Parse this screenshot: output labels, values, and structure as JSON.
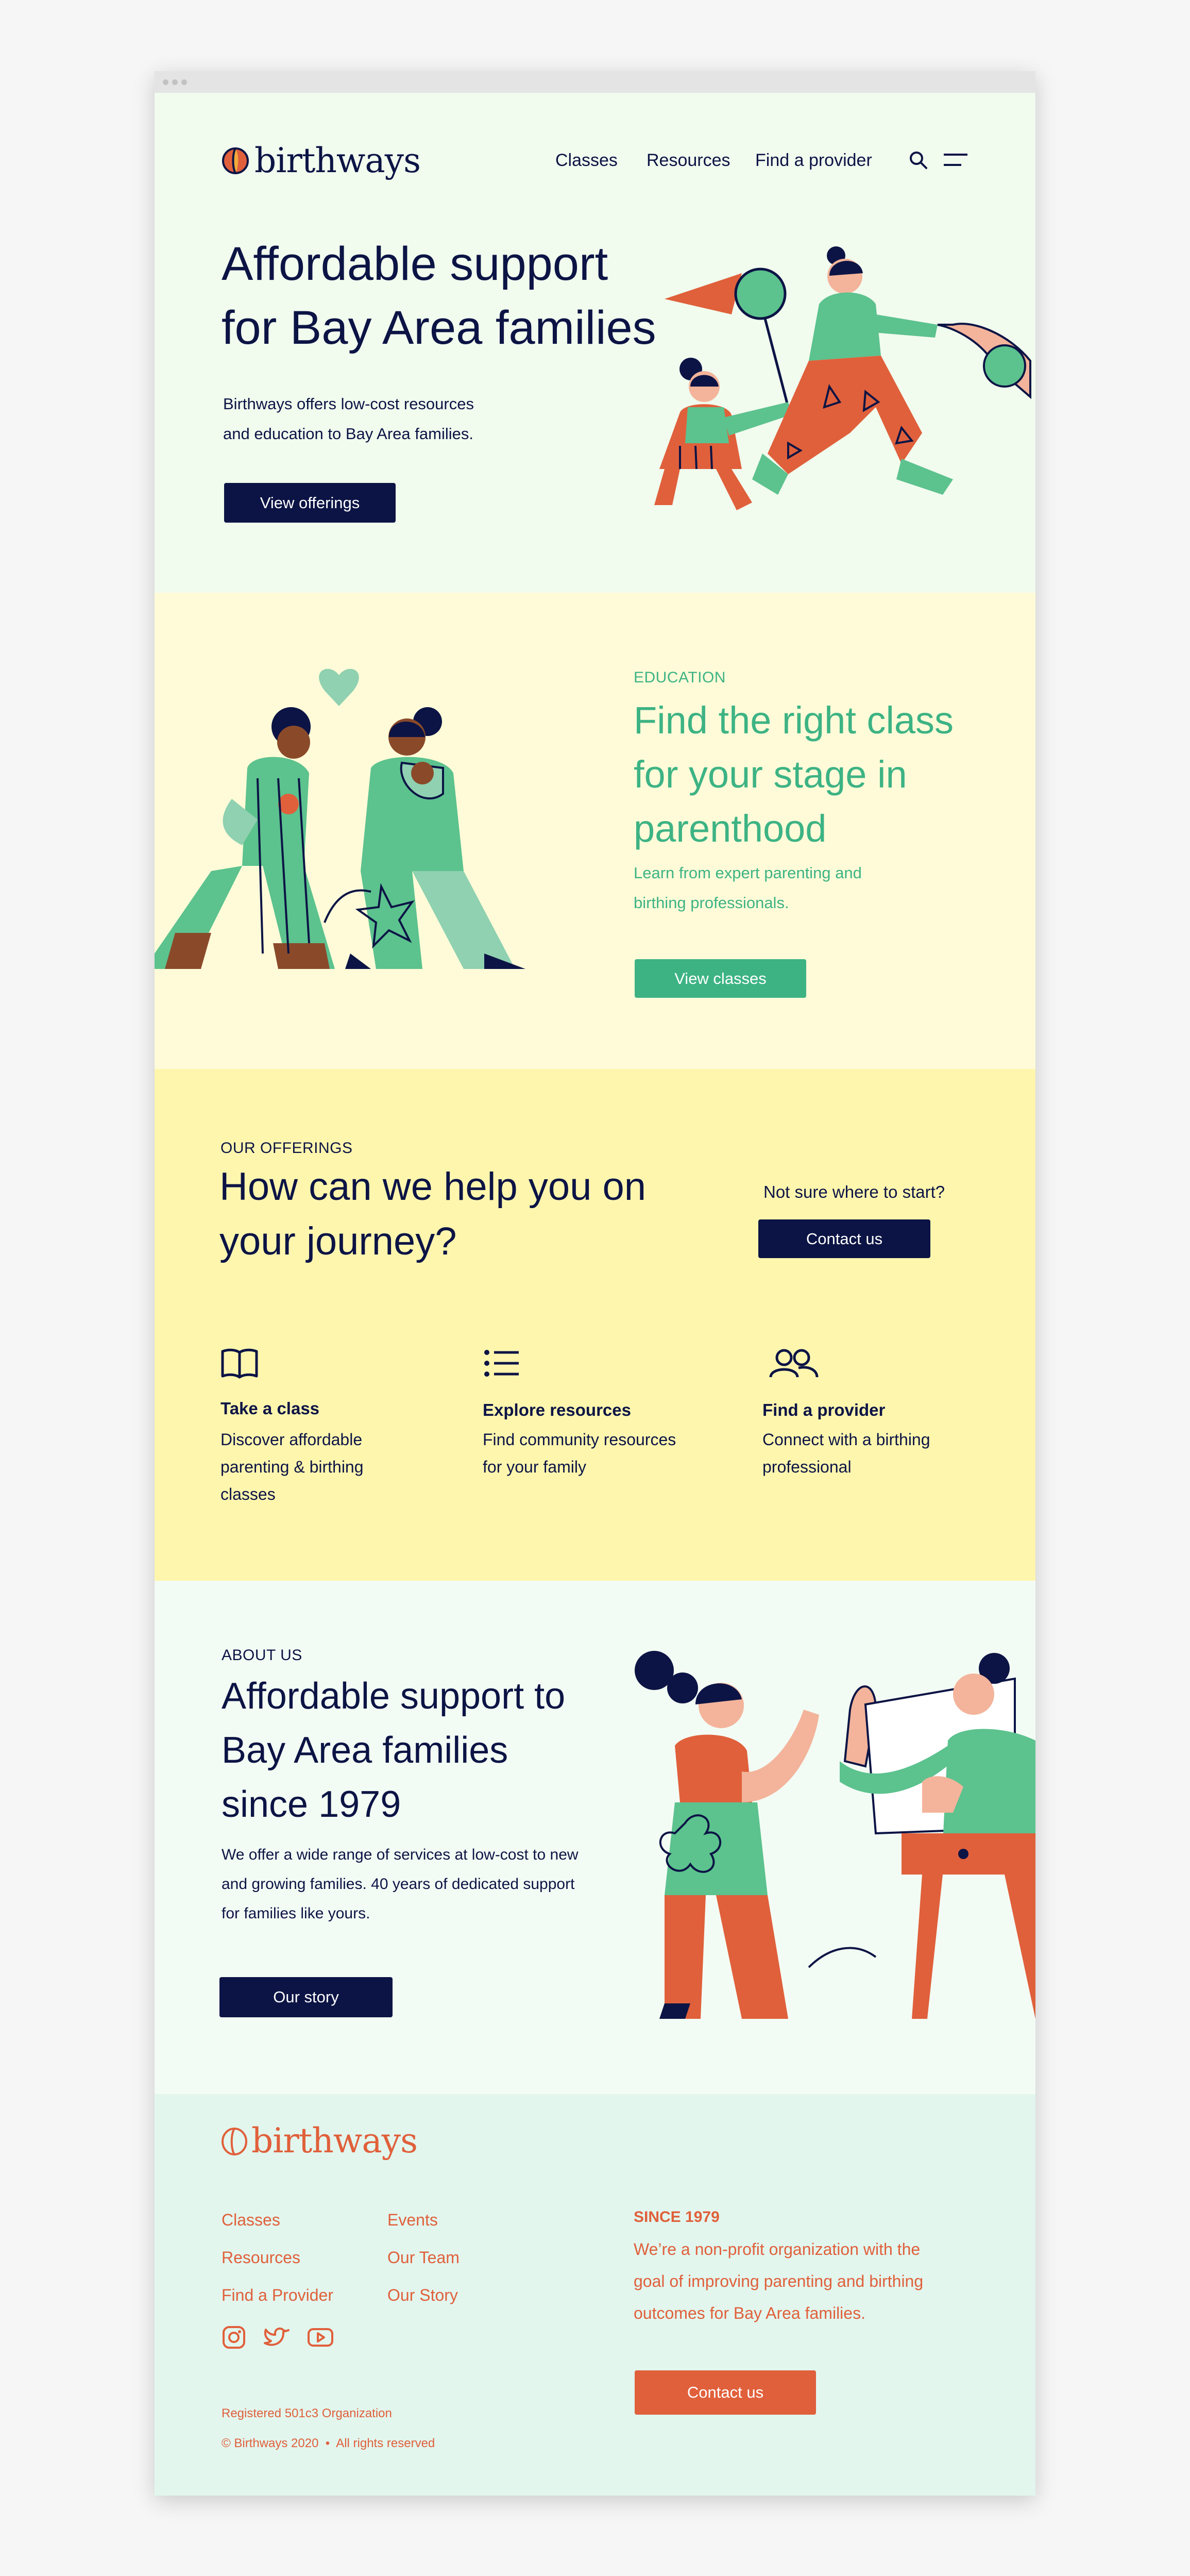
{
  "brand": {
    "name": "birthways"
  },
  "nav": {
    "items": [
      "Classes",
      "Resources",
      "Find a provider"
    ]
  },
  "hero": {
    "title_line1": "Affordable support",
    "title_line2": "for Bay Area families",
    "body_line1": "Birthways offers low-cost resources",
    "body_line2": "and education to Bay Area families.",
    "cta": "View offerings"
  },
  "education": {
    "eyebrow": "EDUCATION",
    "title_line1": "Find the right class",
    "title_line2": "for your stage in",
    "title_line3": "parenthood",
    "body_line1": "Learn from expert parenting and",
    "body_line2": "birthing professionals.",
    "cta": "View classes"
  },
  "offerings": {
    "eyebrow": "OUR OFFERINGS",
    "title_line1": "How can we help you on",
    "title_line2": "your journey?",
    "aside": "Not sure where to start?",
    "contact_cta": "Contact us",
    "items": [
      {
        "icon": "book-icon",
        "title": "Take a class",
        "desc_lines": [
          "Discover affordable",
          "parenting & birthing",
          "classes"
        ]
      },
      {
        "icon": "list-icon",
        "title": "Explore resources",
        "desc_lines": [
          "Find community resources",
          "for your family"
        ]
      },
      {
        "icon": "people-icon",
        "title": "Find a provider",
        "desc_lines": [
          "Connect with a birthing",
          "professional"
        ]
      }
    ]
  },
  "about": {
    "eyebrow": "ABOUT US",
    "title_line1": "Affordable support to",
    "title_line2": "Bay Area families",
    "title_line3": "since 1979",
    "body_line1": "We offer a wide range of services at low-cost to new",
    "body_line2": "and growing families. 40 years of dedicated support",
    "body_line3": "for families like yours.",
    "cta": "Our story"
  },
  "footer": {
    "links_col1": [
      "Classes",
      "Resources",
      "Find a Provider"
    ],
    "links_col2": [
      "Events",
      "Our Team",
      "Our Story"
    ],
    "social": [
      "instagram-icon",
      "twitter-icon",
      "youtube-icon"
    ],
    "since": "SINCE 1979",
    "mission_line1": "We’re a non-profit organization with the",
    "mission_line2": "goal of improving parenting and birthing",
    "mission_line3": "outcomes for Bay Area families.",
    "cta": "Contact us",
    "registered": "Registered 501c3 Organization",
    "copyright": "© Birthways 2020  •  All rights reserved"
  },
  "colors": {
    "navy": "#0c1445",
    "green": "#3db384",
    "orange": "#e0603b",
    "hero_bg": "#f1fbee",
    "education_bg": "#fffbd8",
    "offerings_bg": "#fff6ae",
    "about_bg": "#f3fcf4",
    "footer_bg": "#e2f6ee"
  }
}
